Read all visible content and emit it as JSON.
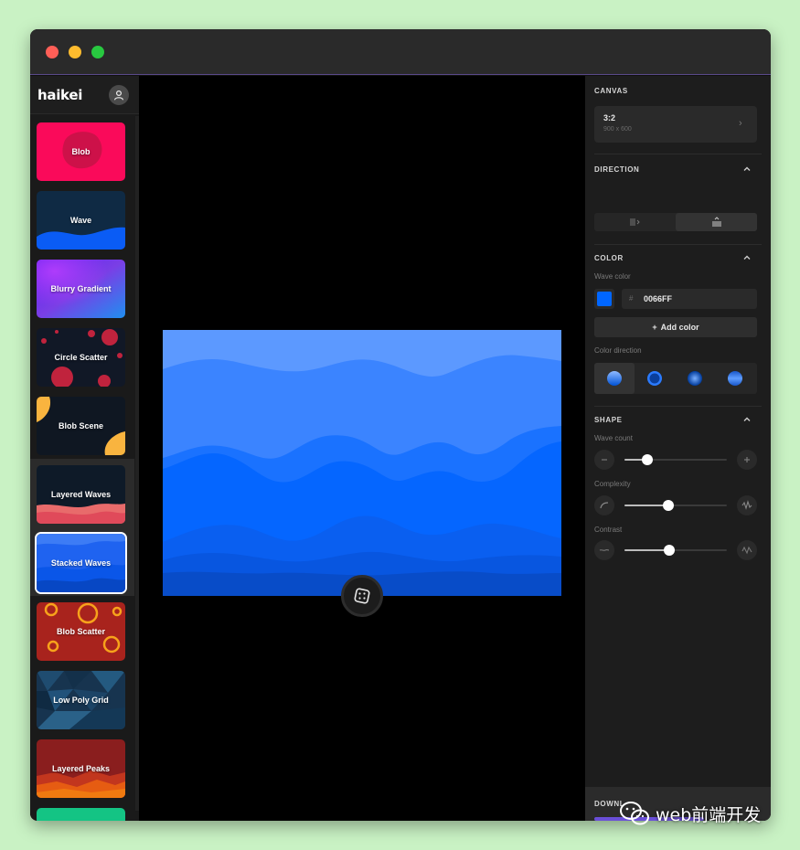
{
  "window": {
    "controls": [
      "close",
      "minimize",
      "zoom"
    ]
  },
  "sidebar": {
    "logo": "haikei",
    "user_icon": "user-icon",
    "items": [
      {
        "label": "Blob"
      },
      {
        "label": "Wave"
      },
      {
        "label": "Blurry Gradient"
      },
      {
        "label": "Circle Scatter"
      },
      {
        "label": "Blob Scene"
      },
      {
        "label": "Layered Waves"
      },
      {
        "label": "Stacked Waves",
        "selected": true
      },
      {
        "label": "Blob Scatter"
      },
      {
        "label": "Low Poly Grid"
      },
      {
        "label": "Layered Peaks"
      }
    ]
  },
  "panel": {
    "canvas": {
      "title": "CANVAS",
      "ratio": "3:2",
      "size": "900 x 600",
      "arrow": "›"
    },
    "direction": {
      "title": "DIRECTION",
      "options": [
        "vertical-bars-icon",
        "stacked-waves-icon"
      ],
      "active": 1
    },
    "color": {
      "title": "COLOR",
      "wave_color_label": "Wave color",
      "hash": "#",
      "hex": "0066FF",
      "swatch": "#0066ff",
      "add_label": "Add color",
      "add_icon": "+",
      "direction_label": "Color direction",
      "direction_active": 0
    },
    "shape": {
      "title": "SHAPE",
      "wave_count": {
        "label": "Wave count",
        "value": 0.22
      },
      "complexity": {
        "label": "Complexity",
        "value": 0.43
      },
      "contrast": {
        "label": "Contrast",
        "value": 0.44
      }
    },
    "download": {
      "title": "DOWNL"
    }
  },
  "watermark": "web前端开发",
  "colors": {
    "accent": "#0066ff",
    "download": "#6a4fd8"
  }
}
